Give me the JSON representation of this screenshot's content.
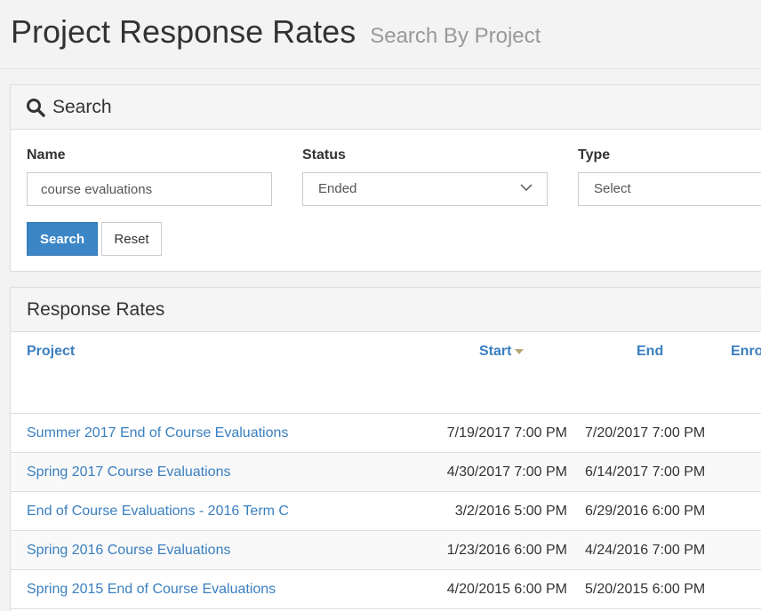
{
  "header": {
    "title": "Project Response Rates",
    "subtitle": "Search By Project"
  },
  "search": {
    "heading": "Search",
    "name_label": "Name",
    "name_value": "course evaluations",
    "status_label": "Status",
    "status_value": "Ended",
    "type_label": "Type",
    "type_value": "Select",
    "search_button": "Search",
    "reset_button": "Reset"
  },
  "results": {
    "heading": "Response Rates",
    "columns": [
      "Project",
      "Start",
      "End",
      "Enro"
    ],
    "sorted_column": "Start",
    "rows": [
      {
        "project": "Summer 2017 End of Course Evaluations",
        "start": "7/19/2017 7:00 PM",
        "end": "7/20/2017 7:00 PM"
      },
      {
        "project": "Spring 2017 Course Evaluations",
        "start": "4/30/2017 7:00 PM",
        "end": "6/14/2017 7:00 PM"
      },
      {
        "project": "End of Course Evaluations - 2016 Term C",
        "start": "3/2/2016 5:00 PM",
        "end": "6/29/2016 6:00 PM"
      },
      {
        "project": "Spring 2016 Course Evaluations",
        "start": "1/23/2016 6:00 PM",
        "end": "4/24/2016 7:00 PM"
      },
      {
        "project": "Spring 2015 End of Course Evaluations",
        "start": "4/20/2015 6:00 PM",
        "end": "5/20/2015 6:00 PM"
      }
    ]
  },
  "colors": {
    "link": "#3a7fc0",
    "primary_button": "#3d86c6"
  }
}
